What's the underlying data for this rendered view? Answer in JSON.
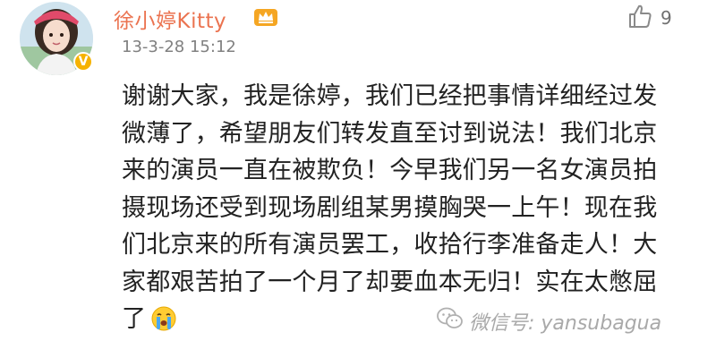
{
  "post": {
    "author": {
      "name": "徐小婷Kitty",
      "avatar": "user-avatar",
      "verified_icon": "verified-v-icon",
      "member_icon": "crown-member-icon"
    },
    "timestamp": "13-3-28 15:12",
    "like": {
      "icon": "thumbs-up-icon",
      "count": "9"
    },
    "text_lines": [
      "谢谢大家，我是徐婷，我们已经把事情详细经过发",
      "微薄了，希望朋友们转发直至讨到说法！我们北京",
      "来的演员一直在被欺负！今早我们另一名女演员拍",
      "摄现场还受到现场剧组某男摸胸哭一上午！现在我",
      "们北京来的所有演员罢工，收拾行李准备走人！大",
      "家都艰苦拍了一个月了却要血本无归！实在太憋屈",
      "了"
    ],
    "emoji": "crying-face-emoji"
  },
  "watermark": {
    "icon": "wechat-logo-icon",
    "text": "微信号: yansubagua"
  },
  "colors": {
    "username": "#eb7350",
    "timestamp": "#808080",
    "body_text": "#222222",
    "watermark": "#a9a9a9",
    "verified_badge": "#f6b200"
  }
}
